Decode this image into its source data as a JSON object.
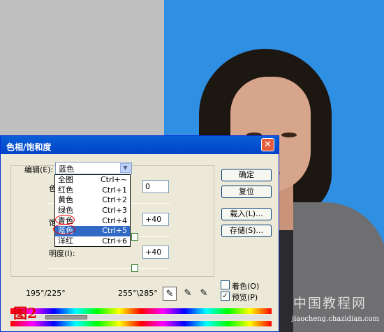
{
  "dialog": {
    "title": "色相/饱和度",
    "edit_label": "编辑(E):",
    "edit_value": "蓝色",
    "hue_label": "色",
    "hue_value": "0",
    "saturation_label": "饱",
    "saturation_value": "+40",
    "lightness_label": "明度(I):",
    "lightness_value": "+40",
    "buttons": {
      "ok": "确定",
      "reset": "复位",
      "load": "载入(L)...",
      "save": "存储(S)..."
    },
    "colorize": {
      "label": "着色(O)",
      "checked": false
    },
    "preview": {
      "label": "预览(P)",
      "checked": true
    },
    "range_left": "195°/225°",
    "range_right": "255°\\285°",
    "annotation": "图2"
  },
  "dropdown": {
    "items": [
      {
        "label": "全图",
        "shortcut": "Ctrl+~"
      },
      {
        "label": "红色",
        "shortcut": "Ctrl+1"
      },
      {
        "label": "黄色",
        "shortcut": "Ctrl+2"
      },
      {
        "label": "绿色",
        "shortcut": "Ctrl+3"
      },
      {
        "label": "青色",
        "shortcut": "Ctrl+4"
      },
      {
        "label": "蓝色",
        "shortcut": "Ctrl+5"
      },
      {
        "label": "洋红",
        "shortcut": "Ctrl+6"
      }
    ],
    "selected_index": 5
  },
  "watermark": {
    "site_name": "中国教程网",
    "url": "jiaocheng.chazidian.com"
  },
  "colors": {
    "photo_background": "#2f8fe3",
    "dialog_background": "#ece9d8",
    "selection": "#316ac5"
  }
}
